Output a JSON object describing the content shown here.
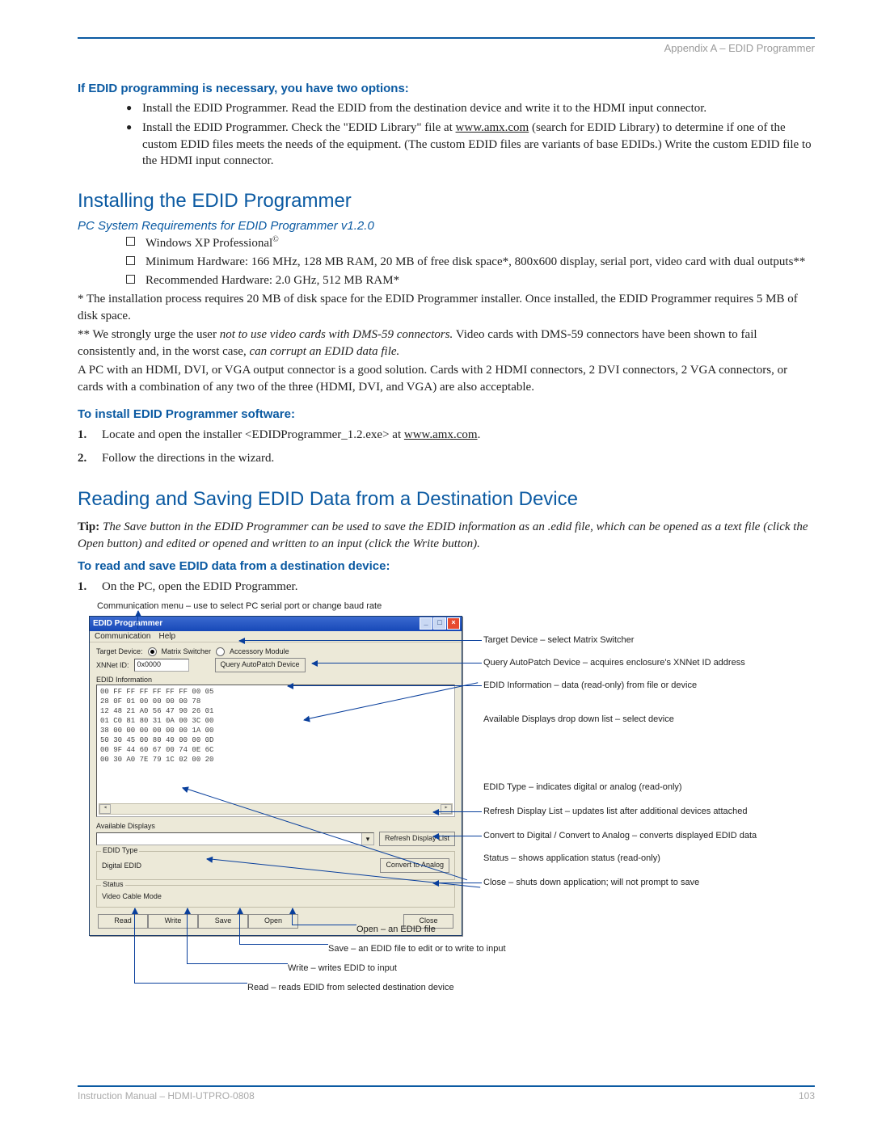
{
  "header": {
    "breadcrumb": "Appendix A – EDID Programmer"
  },
  "section1": {
    "heading": "If EDID programming is necessary, you have two options:",
    "bullets": [
      "Install the EDID Programmer. Read the EDID from the destination device and write it to the HDMI input connector.",
      "Install the EDID Programmer. Check the \"EDID Library\" file at www.amx.com (search for EDID Library) to determine if one of the custom EDID files meets the needs of the equipment. (The custom EDID files are variants of base EDIDs.) Write the custom EDID file to the HDMI input connector."
    ]
  },
  "install": {
    "heading": "Installing the EDID Programmer",
    "req_heading": "PC System Requirements for EDID Programmer v1.2.0",
    "checks": [
      "Windows XP Professional©",
      "Minimum Hardware: 166 MHz, 128 MB RAM, 20 MB of free disk space*, 800x600 display, serial port, video card with dual outputs**",
      "Recommended Hardware: 2.0 GHz, 512 MB RAM*"
    ],
    "note1": "* The installation process requires 20 MB of disk space for the EDID Programmer installer. Once installed, the EDID Programmer requires 5 MB of disk space.",
    "note2_prefix": "** We strongly urge the user ",
    "note2_em": "not to use video cards with DMS-59 connectors.",
    "note2_suffix": " Video cards with DMS-59 connectors have been shown to fail consistently and, in the worst case, ",
    "note2_em2": "can corrupt an EDID data file.",
    "note3": "A PC with an HDMI, DVI, or VGA output connector is a good solution. Cards with 2 HDMI connectors, 2 DVI connectors, 2 VGA connectors, or cards with a combination of any two of the three (HDMI, DVI, and VGA) are also acceptable.",
    "toinstall_heading": "To install EDID Programmer software:",
    "steps": [
      "Locate and open the installer <EDIDProgrammer_1.2.exe> at www.amx.com.",
      "Follow the directions in the wizard."
    ]
  },
  "reading": {
    "heading": "Reading and Saving EDID Data from a Destination Device",
    "tip_label": "Tip:",
    "tip": "The Save button in the EDID Programmer can be used to save the EDID information as an .edid file, which can be opened as a text file (click the Open button) and edited or opened and written to an input (click the Write button).",
    "sub_heading": "To read and save EDID data from a destination device:",
    "step1": "On the PC, open the EDID Programmer."
  },
  "annotations": {
    "top": "Communication menu – use to select PC serial port or change baud rate",
    "right": [
      "Target Device – select Matrix Switcher",
      "Query AutoPatch Device – acquires enclosure's XNNet ID address",
      "EDID Information – data (read-only) from file or device",
      "Available Displays drop down list – select device",
      "EDID Type – indicates digital or analog (read-only)",
      "Refresh Display List – updates list after additional devices attached",
      "Convert to Digital / Convert to Analog – converts displayed EDID data",
      "Status – shows application status (read-only)",
      "Close – shuts down application; will not prompt to save"
    ],
    "bottom": [
      "Open – an EDID file",
      "Save – an EDID file to edit or to write to input",
      "Write – writes EDID to input",
      "Read – reads EDID from selected destination device"
    ]
  },
  "app": {
    "title": "EDID Programmer",
    "menu": [
      "Communication",
      "Help"
    ],
    "target_label": "Target Device:",
    "radio1": "Matrix Switcher",
    "radio2": "Accessory Module",
    "xnnet_label": "XNNet ID:",
    "xnnet_value": "0x0000",
    "query_btn": "Query AutoPatch Device",
    "edid_info_label": "EDID Information",
    "hex_rows": [
      "00  FF  FF  FF  FF  FF  FF  00  05",
      "28  0F  01  00  00  00  00  78",
      "12  48  21  A0  56  47  90  26  01",
      "01  C0  81  80  31  0A  00  3C  00",
      "38  00  00  00  00  00  00  1A  00",
      "50  30  45  00  80  40  00  00  0D",
      "00  9F  44  60  67  00  74  0E  6C",
      "00  30  A0  7E  79  1C  02  00  20"
    ],
    "avail_label": "Available Displays",
    "refresh_btn": "Refresh Display List",
    "edid_type_label": "EDID Type",
    "edid_type_value": "Digital EDID",
    "convert_btn": "Convert to Analog",
    "status_label": "Status",
    "status_value": "Video Cable Mode",
    "footer_btns": [
      "Read",
      "Write",
      "Save",
      "Open",
      "Close"
    ]
  },
  "footer": {
    "left": "Instruction Manual – HDMI-UTPRO-0808",
    "right": "103"
  }
}
